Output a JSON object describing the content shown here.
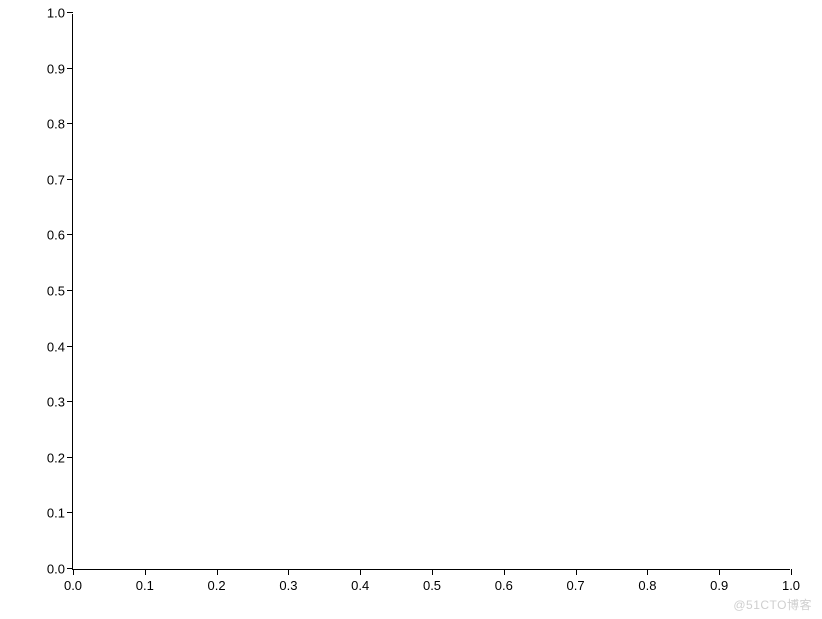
{
  "chart_data": {
    "type": "line",
    "series": [],
    "x_ticks": [
      "0.0",
      "0.1",
      "0.2",
      "0.3",
      "0.4",
      "0.5",
      "0.6",
      "0.7",
      "0.8",
      "0.9",
      "1.0"
    ],
    "y_ticks": [
      "0.0",
      "0.1",
      "0.2",
      "0.3",
      "0.4",
      "0.5",
      "0.6",
      "0.7",
      "0.8",
      "0.9",
      "1.0"
    ],
    "xlim": [
      0.0,
      1.0
    ],
    "ylim": [
      0.0,
      1.0
    ],
    "title": "",
    "xlabel": "",
    "ylabel": "",
    "grid": false,
    "top_spine": false,
    "right_spine": false
  },
  "watermark": "@51CTO博客"
}
